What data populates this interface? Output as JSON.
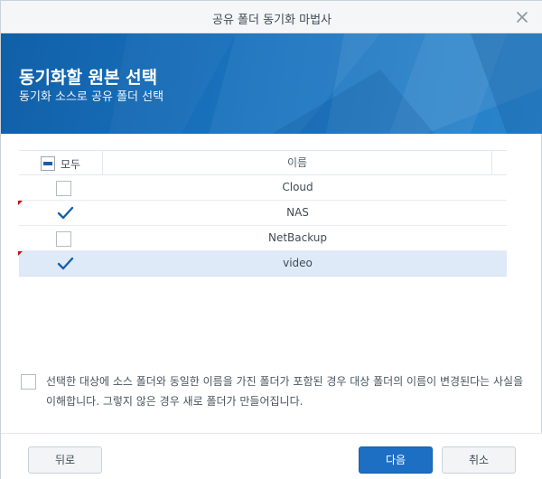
{
  "window": {
    "title": "공유 폴더 동기화 마법사"
  },
  "header": {
    "title": "동기화할 원본 선택",
    "subtitle": "동기화 소스로 공유 폴더 선택"
  },
  "grid": {
    "select_all_label": "모두",
    "name_header": "이름",
    "rows": [
      {
        "name": "Cloud",
        "checked": false,
        "selected": false,
        "marked": false
      },
      {
        "name": "NAS",
        "checked": true,
        "selected": false,
        "marked": true
      },
      {
        "name": "NetBackup",
        "checked": false,
        "selected": false,
        "marked": false
      },
      {
        "name": "video",
        "checked": true,
        "selected": true,
        "marked": true
      }
    ]
  },
  "agree": {
    "checked": false,
    "text": "선택한 대상에 소스 폴더와 동일한 이름을 가진 폴더가 포함된 경우 대상 폴더의 이름이 변경된다는 사실을 이해합니다. 그렇지 않은 경우 새로 폴더가 만들어집니다."
  },
  "footer": {
    "back_label": "뒤로",
    "next_label": "다음",
    "cancel_label": "취소"
  },
  "colors": {
    "header_blue": "#1a72bd",
    "primary_button": "#1d6fc4",
    "selected_row": "#deeaf7",
    "checkmark": "#1a5fa8",
    "dirty_marker": "#c0121d"
  }
}
